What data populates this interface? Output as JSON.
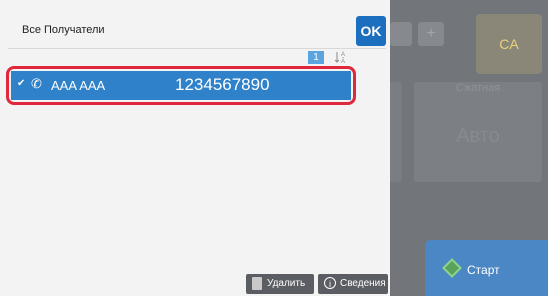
{
  "background": {
    "tab_plus": "+",
    "ca_label": "CA",
    "panel_label": "Сжатная",
    "auto_label": "Авто",
    "start_label": "Старт"
  },
  "dialog": {
    "title": "Все Получатели",
    "ok_label": "OK",
    "page_number": "1",
    "sort_icon": "sort-az-icon",
    "recipients": [
      {
        "name": "AAA AAA",
        "number": "1234567890",
        "type_icon": "phone-icon",
        "selected": true
      }
    ],
    "delete_label": "Удалить",
    "info_label": "Сведения"
  },
  "colors": {
    "accent": "#2f82c9",
    "highlight": "#e0283c",
    "ok_button": "#1c6fbf"
  }
}
